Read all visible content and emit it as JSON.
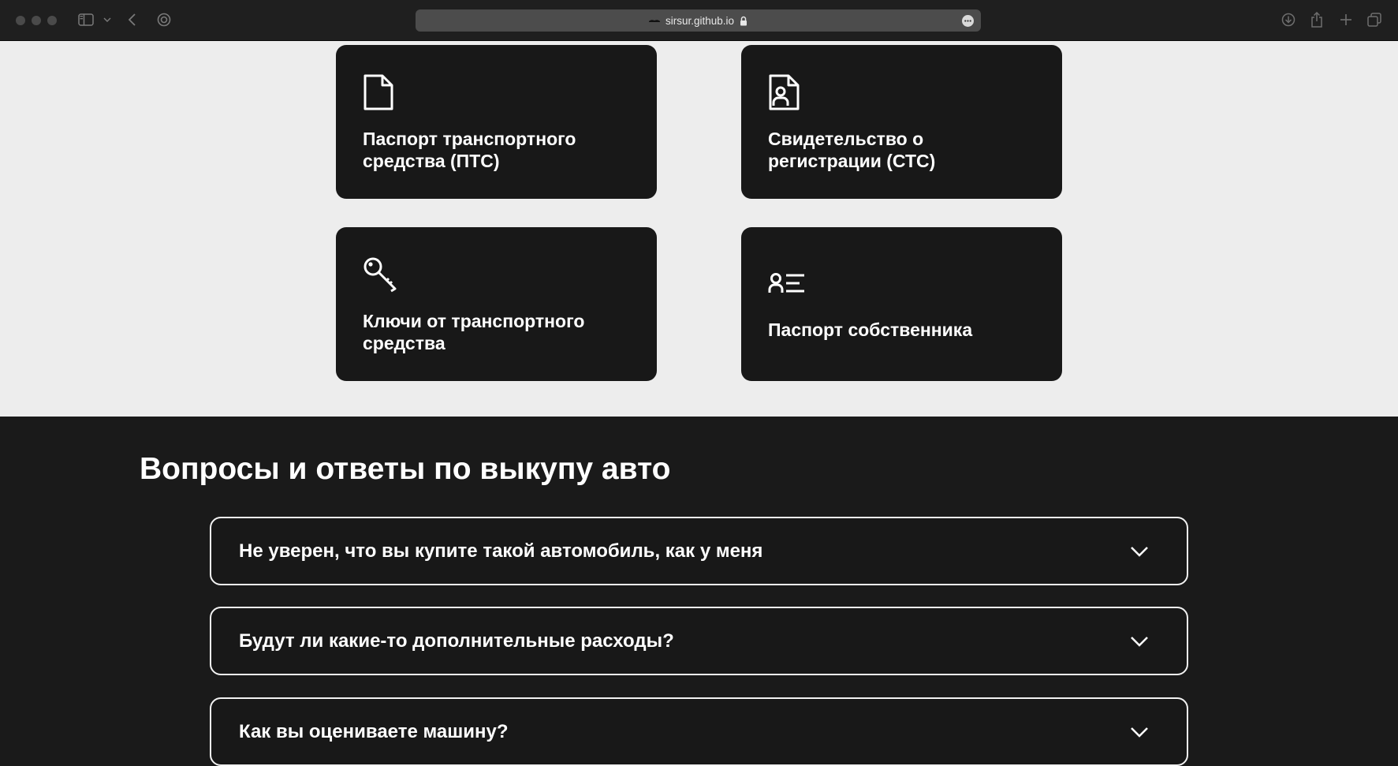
{
  "browser": {
    "url": "sirsur.github.io",
    "icons": [
      "sidebar-icon",
      "chevron-down-icon",
      "back-icon",
      "privacy-icon",
      "lock-icon",
      "more-icon",
      "download-icon",
      "share-icon",
      "plus-icon",
      "tabs-icon"
    ]
  },
  "documents": {
    "cards": [
      {
        "icon": "document-icon",
        "title": "Паспорт транспортного\nсредства (ПТС)"
      },
      {
        "icon": "registration-certificate-icon",
        "title": "Свидетельство о\nрегистрации (СТС)"
      },
      {
        "icon": "key-icon",
        "title": "Ключи от транспортного\nсредства"
      },
      {
        "icon": "id-card-icon",
        "title": "Паспорт собственника"
      }
    ]
  },
  "faq": {
    "heading": "Вопросы и ответы по выкупу авто",
    "items": [
      {
        "question": "Не уверен, что вы купите такой автомобиль, как у меня"
      },
      {
        "question": "Будут ли какие-то дополнительные расходы?"
      },
      {
        "question": "Как вы оцениваете машину?"
      }
    ]
  },
  "colors": {
    "page_light": "#ededed",
    "page_dark": "#1a1a1a",
    "card": "#181818",
    "text": "#ffffff"
  }
}
